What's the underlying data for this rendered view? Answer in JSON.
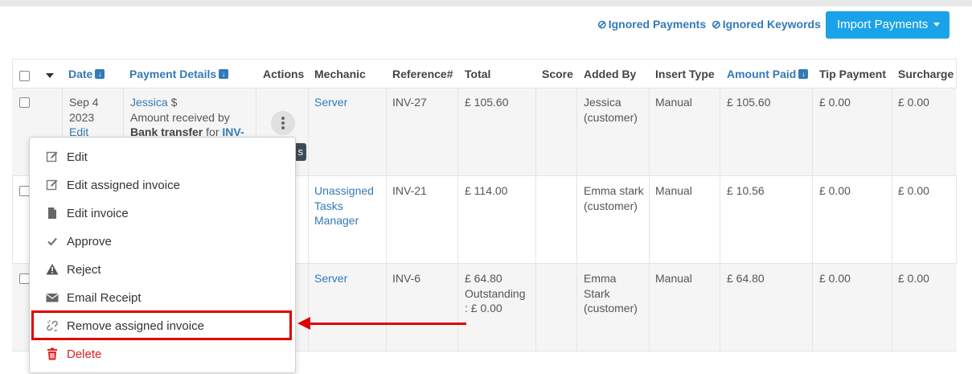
{
  "toolbar": {
    "ignored_payments": "Ignored Payments",
    "ignored_keywords": "Ignored Keywords",
    "import_payments": "Import Payments"
  },
  "table": {
    "headers": {
      "date": "Date",
      "payment_details": "Payment Details",
      "actions": "Actions",
      "mechanic": "Mechanic",
      "reference": "Reference#",
      "total": "Total",
      "score": "Score",
      "added_by": "Added By",
      "insert_type": "Insert Type",
      "amount_paid": "Amount Paid",
      "tip_payment": "Tip Payment",
      "surcharge": "Surcharge"
    },
    "rows": [
      {
        "date_line1": "Sep 4",
        "date_line2": "2023",
        "date_edit": "Edit",
        "customer": "Jessica",
        "currency_symbol": "$",
        "details_text": "Amount received by",
        "method": "Bank transfer",
        "for_text": "for",
        "invoice_prefix": "INV-",
        "mechanic": "Server",
        "reference": "INV-27",
        "total": "£ 105.60",
        "added_by_1": "Jessica",
        "added_by_2": "(customer)",
        "insert_type": "Manual",
        "amount_paid": "£ 105.60",
        "tip": "£ 0.00",
        "surcharge": "£ 0.00"
      },
      {
        "mechanic_1": "Unassigned",
        "mechanic_2": "Tasks",
        "mechanic_3": "Manager",
        "reference": "INV-21",
        "total": "£ 114.00",
        "added_by_1": "Emma stark",
        "added_by_2": "(customer)",
        "insert_type": "Manual",
        "amount_paid": "£ 10.56",
        "tip": "£ 0.00",
        "surcharge": "£ 0.00"
      },
      {
        "mechanic": "Server",
        "reference": "INV-6",
        "total_1": "£ 64.80",
        "total_2": "Outstanding",
        "total_3": ": £ 0.00",
        "added_by_1": "Emma",
        "added_by_2": "Stark",
        "added_by_3": "(customer)",
        "insert_type": "Manual",
        "amount_paid": "£ 64.80",
        "tip": "£ 0.00",
        "surcharge": "£ 0.00"
      }
    ]
  },
  "action_menu": {
    "items": [
      {
        "label": "Edit",
        "icon": "edit-icon"
      },
      {
        "label": "Edit assigned invoice",
        "icon": "edit-icon"
      },
      {
        "label": "Edit invoice",
        "icon": "file-icon"
      },
      {
        "label": "Approve",
        "icon": "check-icon"
      },
      {
        "label": "Reject",
        "icon": "warning-icon"
      },
      {
        "label": "Email Receipt",
        "icon": "envelope-icon"
      },
      {
        "label": "Remove assigned invoice",
        "icon": "unlink-icon"
      },
      {
        "label": "Delete",
        "icon": "trash-icon"
      }
    ]
  },
  "colors": {
    "link": "#337ab7",
    "primary_button": "#1aa3e8",
    "danger": "#e02020",
    "annotation_red": "#e00000"
  }
}
